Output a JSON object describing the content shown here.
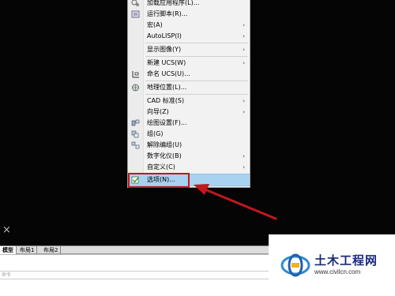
{
  "menu": {
    "items": [
      {
        "label": "加载应用程序(L)...",
        "has_submenu": false,
        "icon": "app-load-icon"
      },
      {
        "label": "运行脚本(R)...",
        "has_submenu": false,
        "icon": "script-icon"
      },
      {
        "label": "宏(A)",
        "has_submenu": true,
        "icon": ""
      },
      {
        "label": "AutoLISP(I)",
        "has_submenu": true,
        "icon": ""
      },
      {
        "label": "显示图像(Y)",
        "has_submenu": true,
        "icon": ""
      },
      {
        "label": "新建 UCS(W)",
        "has_submenu": true,
        "icon": ""
      },
      {
        "label": "命名 UCS(U)...",
        "has_submenu": false,
        "icon": "ucs-icon"
      },
      {
        "label": "地理位置(L)...",
        "has_submenu": false,
        "icon": "globe-icon"
      },
      {
        "label": "CAD 标准(S)",
        "has_submenu": true,
        "icon": ""
      },
      {
        "label": "向导(Z)",
        "has_submenu": true,
        "icon": ""
      },
      {
        "label": "绘图设置(F)...",
        "has_submenu": false,
        "icon": "drafting-settings-icon"
      },
      {
        "label": "组(G)",
        "has_submenu": false,
        "icon": "group-icon"
      },
      {
        "label": "解除编组(U)",
        "has_submenu": false,
        "icon": "ungroup-icon"
      },
      {
        "label": "数字化仪(B)",
        "has_submenu": true,
        "icon": ""
      },
      {
        "label": "自定义(C)",
        "has_submenu": true,
        "icon": ""
      },
      {
        "label": "选项(N)...",
        "has_submenu": false,
        "icon": "options-checkbox-icon",
        "selected": true
      }
    ]
  },
  "layout_tabs": {
    "model": "模型",
    "layout1": "布局1",
    "layout2": "布局2"
  },
  "command_line": {
    "prompt": "命令"
  },
  "watermark": {
    "title": "土木工程网",
    "url": "www.civilcn.com"
  },
  "colors": {
    "highlight_box": "#c0181c",
    "arrow": "#c0181c",
    "selected_item": "#a9d2f1",
    "watermark_title": "#1a2a7a"
  }
}
